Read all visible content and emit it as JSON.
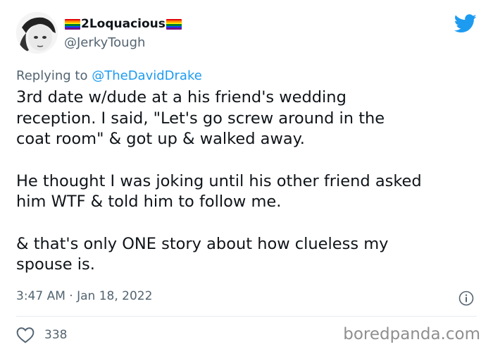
{
  "tweet": {
    "display_name": "2Loquacious",
    "handle": "@JerkyTough",
    "replying_prefix": "Replying to",
    "replying_to": "@TheDavidDrake",
    "paragraphs": [
      "3rd date w/dude at a his friend's wedding\nreception. I said, \"Let's go screw around in the\ncoat room\" & got up & walked away.",
      "He thought I was joking until his other friend asked\nhim WTF & told him to follow me.",
      "& that's only ONE story about how clueless my\nspouse is."
    ],
    "timestamp": "3:47 AM · Jan 18, 2022",
    "likes": "338"
  },
  "watermark": "boredpanda.com",
  "colors": {
    "twitter_blue": "#1d9bf0",
    "secondary_text": "#536471",
    "rainbow": [
      "#e40303",
      "#ff8c00",
      "#ffed00",
      "#008026",
      "#004dff",
      "#750787"
    ]
  },
  "icons": [
    "twitter-bird-icon",
    "info-icon",
    "heart-icon",
    "rainbow-flag-icon"
  ]
}
